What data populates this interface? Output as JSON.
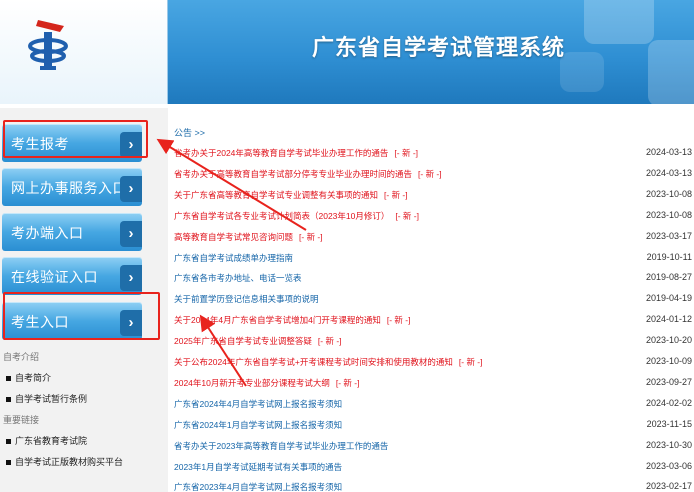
{
  "header": {
    "title": "广东省自学考试管理系统",
    "logo_icon": "education-logo-icon"
  },
  "sidebar": {
    "nav": [
      {
        "label": "考生报考",
        "arrow": "›"
      },
      {
        "label": "网上办事服务入口",
        "arrow": "›"
      },
      {
        "label": "考办端入口",
        "arrow": "›"
      },
      {
        "label": "在线验证入口",
        "arrow": "›"
      },
      {
        "label": "考生入口",
        "arrow": "›"
      }
    ],
    "section1_title": "自考介绍",
    "section1_links": [
      "自考简介",
      "自学考试暂行条例"
    ],
    "section2_title": "重要链接",
    "section2_links": [
      "广东省教育考试院",
      "自学考试正版教材购买平台"
    ]
  },
  "notices": {
    "heading": "公告 >>",
    "new_tag": "[- 新 -]",
    "items": [
      {
        "title": "省考办关于2024年高等教育自学考试毕业办理工作的通告",
        "new": true,
        "color": "red",
        "date": "2024-03-13"
      },
      {
        "title": "省考办关于高等教育自学考试部分停考专业毕业办理时间的通告",
        "new": true,
        "color": "red",
        "date": "2024-03-13"
      },
      {
        "title": "关于广东省高等教育自学考试专业调整有关事项的通知",
        "new": true,
        "color": "red",
        "date": "2023-10-08"
      },
      {
        "title": "广东省自学考试各专业考试计划简表（2023年10月修订）",
        "new": true,
        "color": "red",
        "date": "2023-10-08"
      },
      {
        "title": "高等教育自学考试常见咨询问题",
        "new": true,
        "color": "red",
        "date": "2023-03-17"
      },
      {
        "title": "广东省自学考试成绩单办理指南",
        "new": false,
        "color": "blue",
        "date": "2019-10-11"
      },
      {
        "title": "广东省各市考办地址、电话一览表",
        "new": false,
        "color": "blue",
        "date": "2019-08-27"
      },
      {
        "title": "关于前置学历登记信息相关事项的说明",
        "new": false,
        "color": "blue",
        "date": "2019-04-19"
      },
      {
        "title": "关于2024年4月广东省自学考试增加4门开考课程的通知",
        "new": true,
        "color": "red",
        "date": "2024-01-12"
      },
      {
        "title": "2025年广东省自学考试专业调整答疑",
        "new": true,
        "color": "red",
        "date": "2023-10-20"
      },
      {
        "title": "关于公布2024年广东省自学考试+开考课程考试时间安排和使用教材的通知",
        "new": true,
        "color": "red",
        "date": "2023-10-09"
      },
      {
        "title": "2024年10月新开考专业部分课程考试大纲",
        "new": true,
        "color": "red",
        "date": "2023-09-27"
      },
      {
        "title": "广东省2024年4月自学考试网上报名报考须知",
        "new": false,
        "color": "blue",
        "date": "2024-02-02"
      },
      {
        "title": "广东省2024年1月自学考试网上报名报考须知",
        "new": false,
        "color": "blue",
        "date": "2023-11-15"
      },
      {
        "title": "省考办关于2023年高等教育自学考试毕业办理工作的通告",
        "new": false,
        "color": "blue",
        "date": "2023-10-30"
      },
      {
        "title": "2023年1月自学考试延期考试有关事项的通告",
        "new": false,
        "color": "blue",
        "date": "2023-03-06"
      },
      {
        "title": "广东省2023年4月自学考试网上报名报考须知",
        "new": false,
        "color": "blue",
        "date": "2023-02-17"
      }
    ]
  },
  "annotation_color": "#e8231d"
}
